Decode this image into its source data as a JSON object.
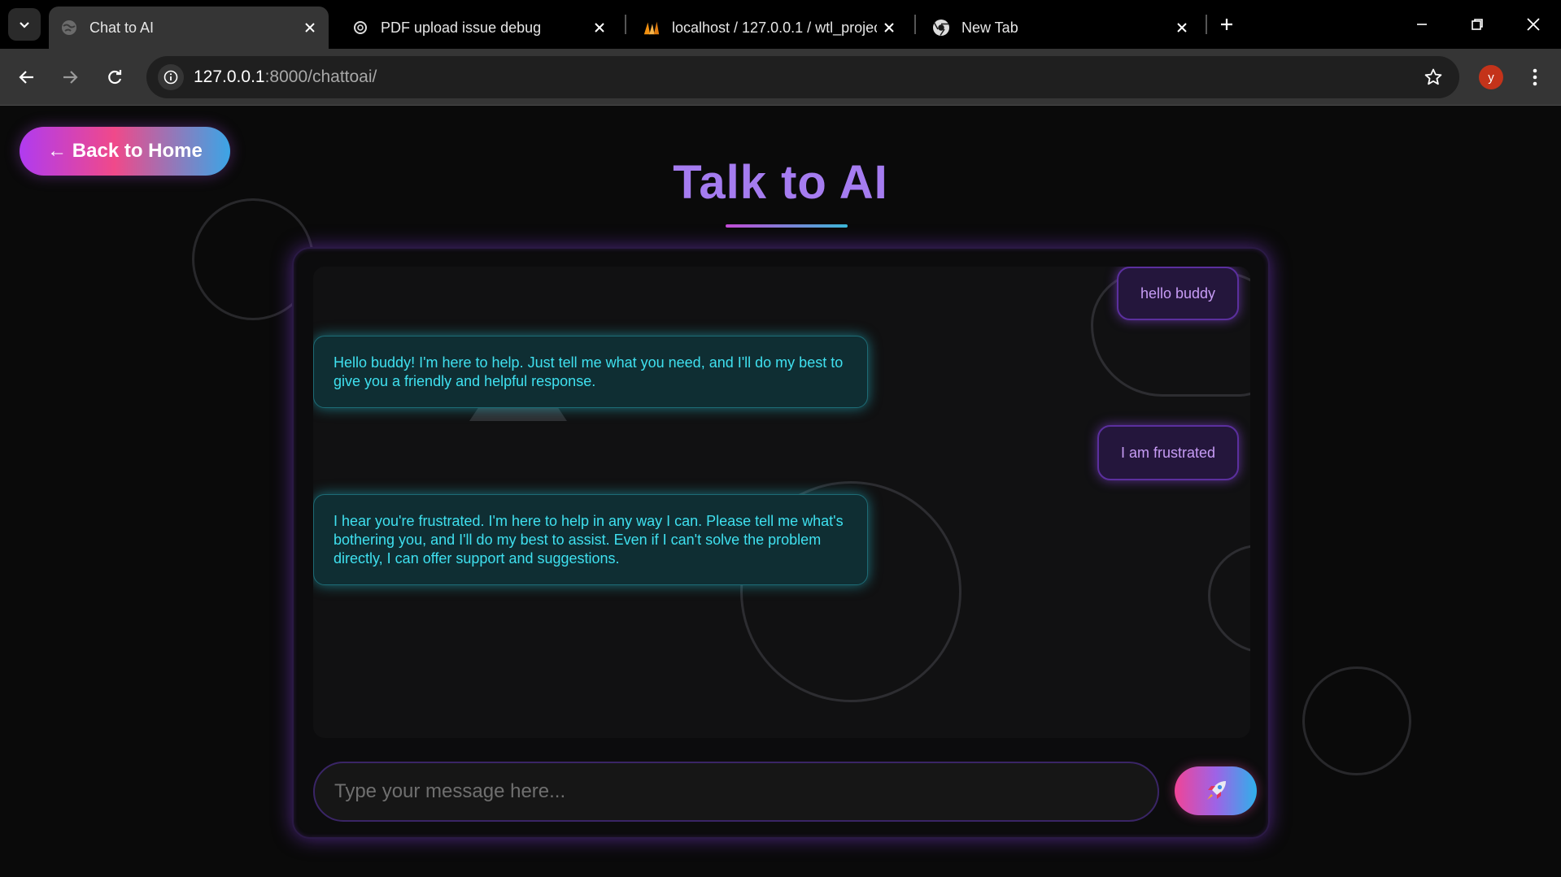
{
  "browser": {
    "tabs": [
      {
        "title": "Chat to AI",
        "icon": "globe-icon",
        "active": true
      },
      {
        "title": "PDF upload issue debug",
        "icon": "openai-icon",
        "active": false
      },
      {
        "title": "localhost / 127.0.0.1 / wtl_projec",
        "icon": "phpmyadmin-icon",
        "active": false
      },
      {
        "title": "New Tab",
        "icon": "chrome-icon",
        "active": false
      }
    ],
    "url_host": "127.0.0.1",
    "url_path": ":8000/chattoai/",
    "profile_initial": "y"
  },
  "page": {
    "back_label": "← Back to Home",
    "title": "Talk to AI"
  },
  "chat": {
    "messages": [
      {
        "role": "user",
        "text": "hello buddy"
      },
      {
        "role": "ai",
        "text": "Hello buddy! I'm here to help. Just tell me what you need, and I'll do my best to give you a friendly and helpful response."
      },
      {
        "role": "user",
        "text": "I am frustrated"
      },
      {
        "role": "ai",
        "text": "I hear you're frustrated. I'm here to help in any way I can. Please tell me what's bothering you, and I'll do my best to assist. Even if I can't solve the problem directly, I can offer support and suggestions."
      }
    ],
    "input_placeholder": "Type your message here...",
    "input_value": "",
    "send_icon": "rocket-icon"
  },
  "colors": {
    "accent_purple": "#a57cf0",
    "ai_text": "#3fe0ef",
    "user_text": "#c79cf5",
    "profile": "#c4331a"
  }
}
